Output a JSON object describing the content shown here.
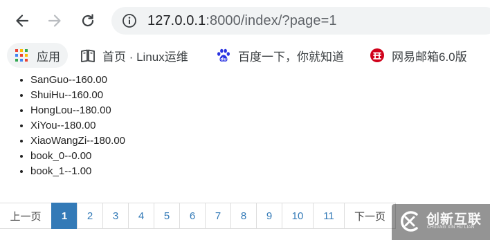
{
  "browser": {
    "url_host": "127.0.0.1",
    "url_rest": ":8000/index/?page=1",
    "bookmarks": [
      {
        "label": "应用",
        "icon": "apps-grid-icon"
      },
      {
        "label": "首页 · Linux运维",
        "icon": "book-icon"
      },
      {
        "label": "百度一下，你就知道",
        "icon": "baidu-paw-icon"
      },
      {
        "label": "网易邮箱6.0版",
        "icon": "netease-mail-icon"
      }
    ]
  },
  "books": [
    "SanGuo--160.00",
    "ShuiHu--160.00",
    "HongLou--180.00",
    "XiYou--180.00",
    "XiaoWangZi--180.00",
    "book_0--0.00",
    "book_1--1.00"
  ],
  "pagination": {
    "prev_label": "上一页",
    "next_label": "下一页",
    "pages": [
      "1",
      "2",
      "3",
      "4",
      "5",
      "6",
      "7",
      "8",
      "9",
      "10",
      "11"
    ],
    "current_page": "1"
  },
  "watermark": {
    "title": "创新互联",
    "subtitle": "CHUANG XIN HU LIAN"
  },
  "colors": {
    "link": "#337ab7",
    "active_page_bg": "#337ab7",
    "omnibox_bg": "#f1f3f4"
  }
}
